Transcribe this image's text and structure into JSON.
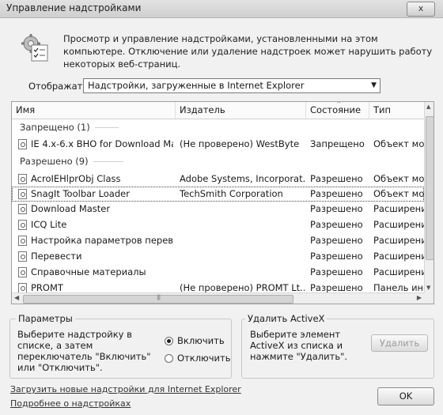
{
  "window": {
    "title": "Управление надстройками",
    "close_label": "x"
  },
  "header": {
    "icon": "gear-checklist-icon",
    "description": "Просмотр и управление надстройками, установленными на этом компьютере. Отключение или удаление надстроек может нарушить работу некоторых веб-страниц."
  },
  "show": {
    "label": "Отображать:",
    "selected": "Надстройки, загруженные в Internet Explorer"
  },
  "list": {
    "columns": [
      "Имя",
      "Издатель",
      "Состояние",
      "Тип"
    ],
    "groups": [
      {
        "label": "Запрещено (1)"
      },
      {
        "label": "Разрешено (9)"
      }
    ],
    "rows": [
      {
        "name": "IE 4.x-6.x BHO for Download Ma...",
        "publisher": "(Не проверено) WestByte",
        "status": "Запрещено",
        "type": "Объект мод"
      },
      {
        "name": "AcroIEHlprObj Class",
        "publisher": "Adobe Systems, Incorporat...",
        "status": "Разрешено",
        "type": "Объект мод"
      },
      {
        "name": "SnagIt Toolbar Loader",
        "publisher": "TechSmith Corporation",
        "status": "Разрешено",
        "type": "Объект мод"
      },
      {
        "name": "Download Master",
        "publisher": "",
        "status": "Разрешено",
        "type": "Расширени"
      },
      {
        "name": "ICQ Lite",
        "publisher": "",
        "status": "Разрешено",
        "type": "Расширени"
      },
      {
        "name": "Настройка параметров перев...",
        "publisher": "",
        "status": "Разрешено",
        "type": "Расширени"
      },
      {
        "name": "Перевести",
        "publisher": "",
        "status": "Разрешено",
        "type": "Расширени"
      },
      {
        "name": "Справочные материалы",
        "publisher": "",
        "status": "Разрешено",
        "type": "Расширени"
      },
      {
        "name": "PROMT",
        "publisher": "(Не проверено) PROMT Lt...",
        "status": "Разрешено",
        "type": "Панель инс"
      }
    ]
  },
  "params": {
    "title": "Параметры",
    "text": "Выберите надстройку в списке, а затем переключатель \"Включить\" или \"Отключить\".",
    "enable_label": "Включить",
    "disable_label": "Отключить"
  },
  "activex": {
    "title": "Удалить ActiveX",
    "text": "Выберите элемент ActiveX из списка и нажмите \"Удалить\".",
    "remove_label": "Удалить"
  },
  "links": {
    "download": "Загрузить новые надстройки для Internet Explorer",
    "more": "Подробнее о надстройках"
  },
  "ok_label": "OK"
}
